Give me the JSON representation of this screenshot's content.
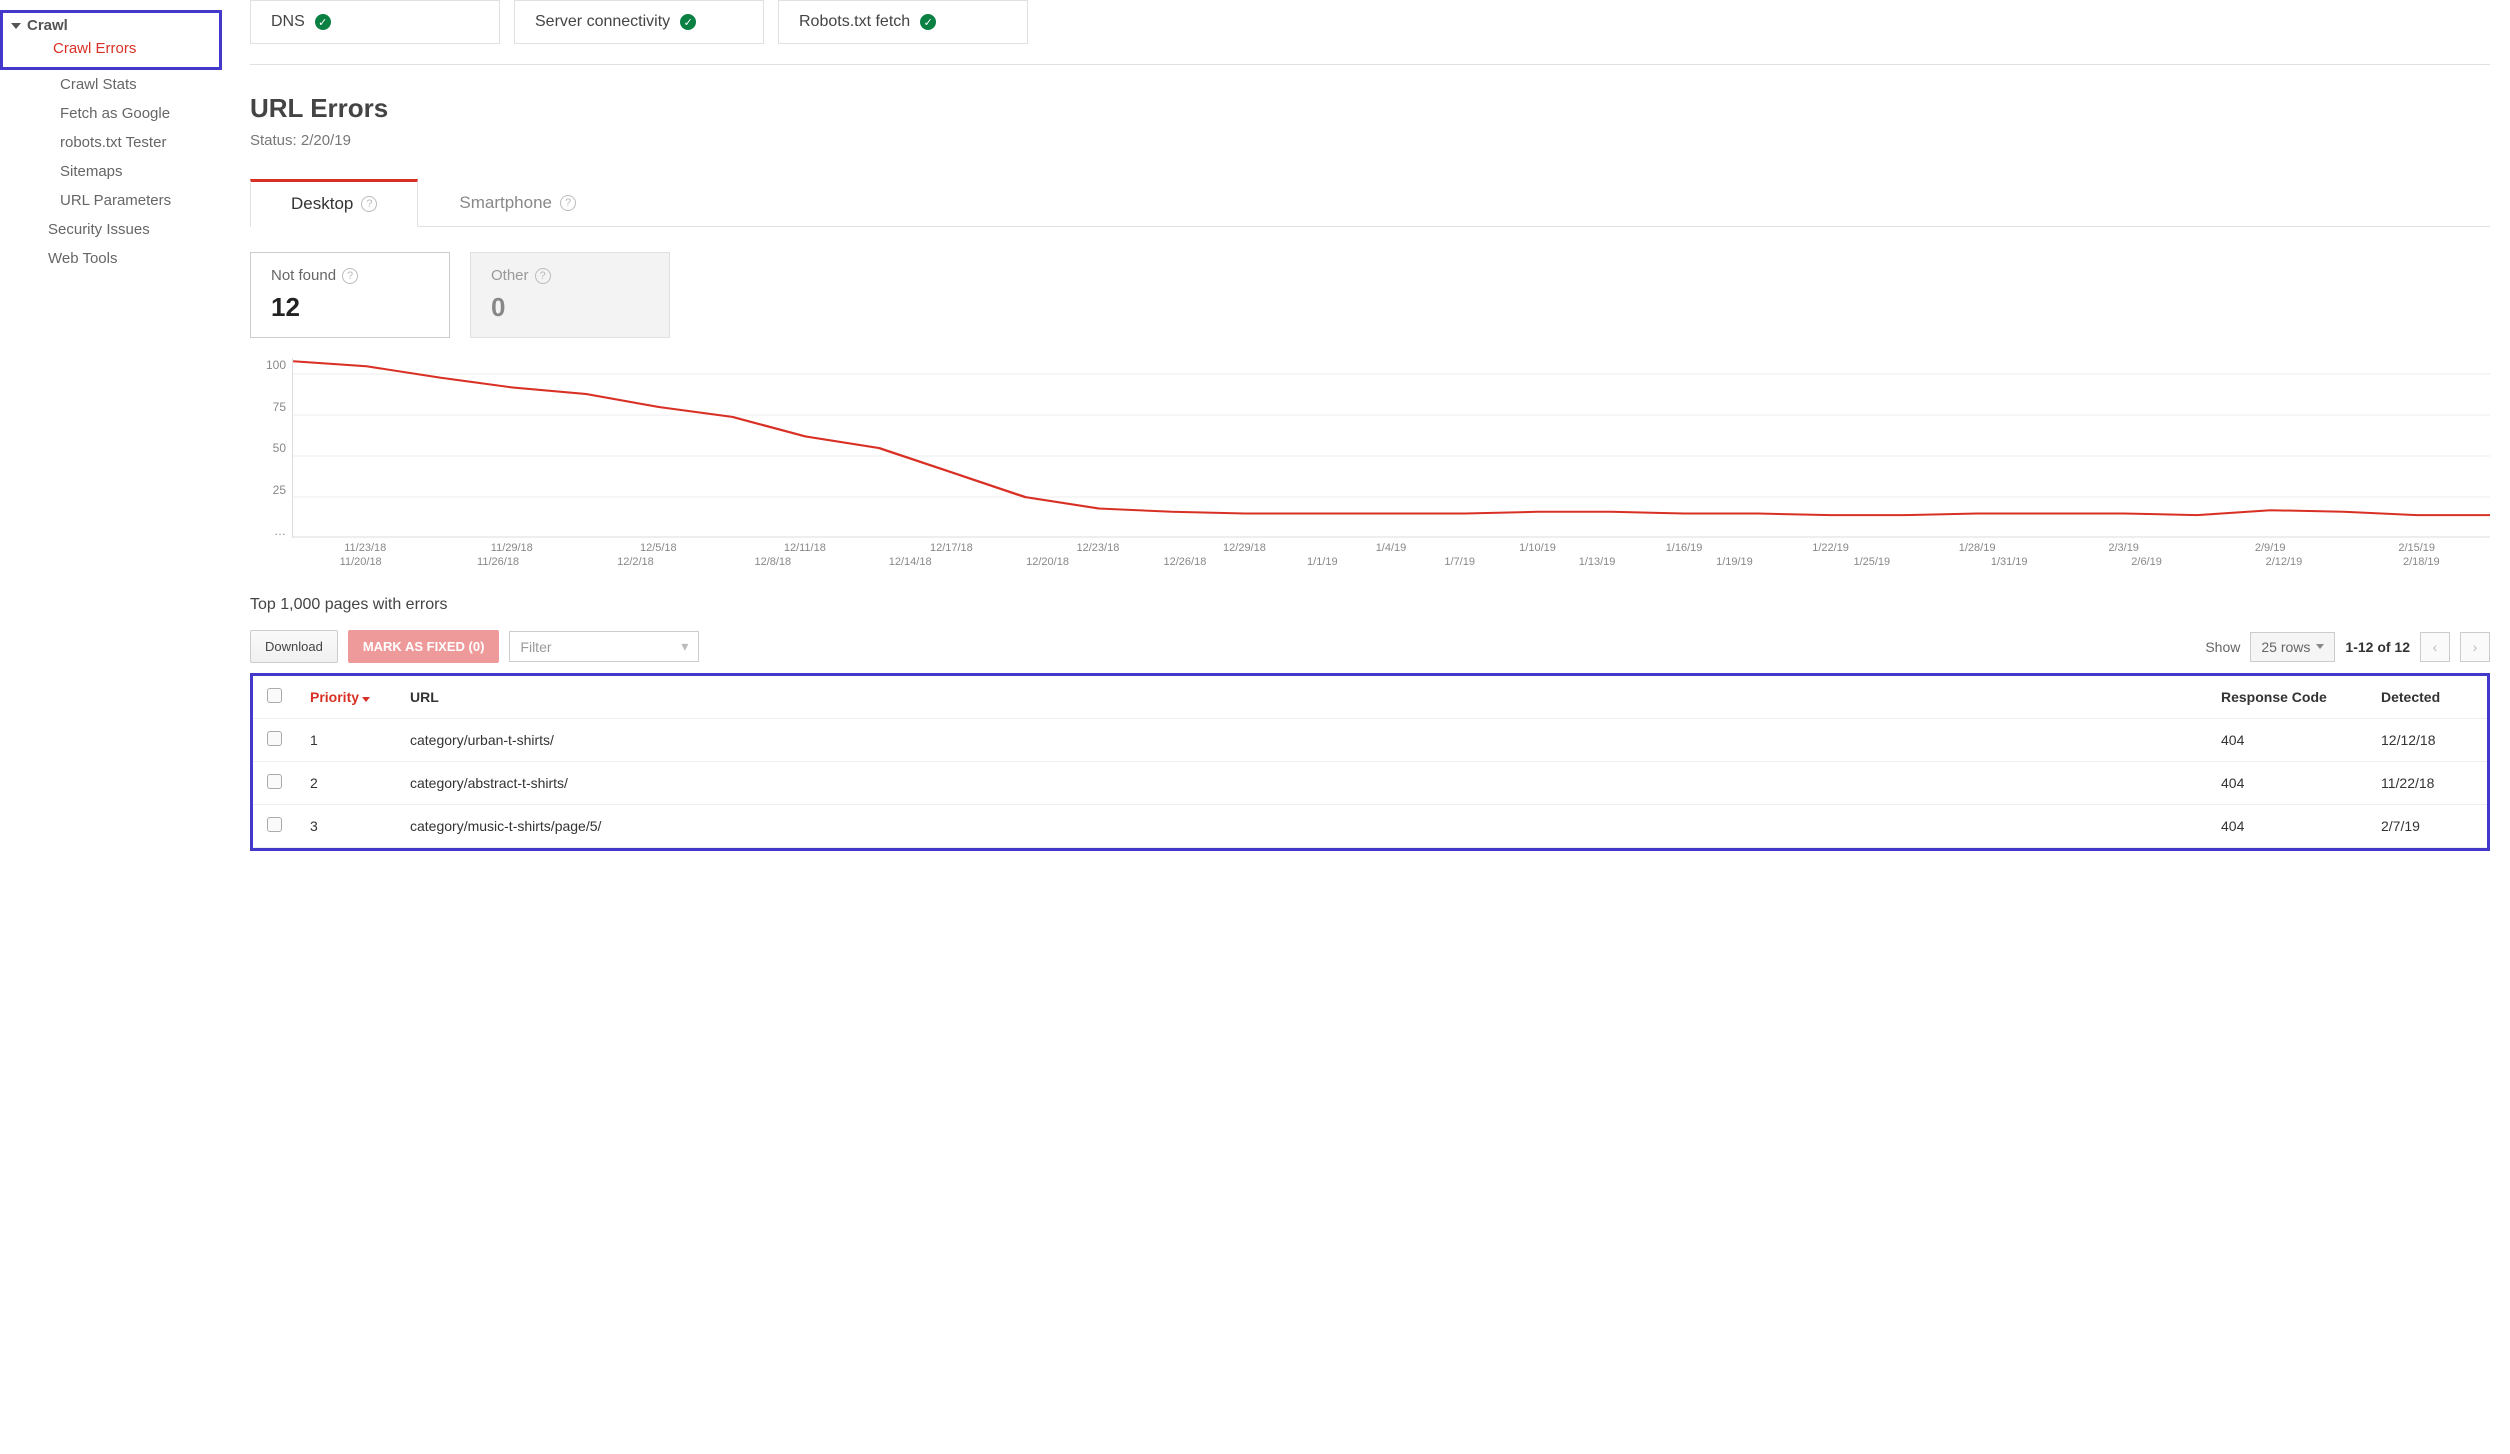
{
  "sidebar": {
    "group_label": "Crawl",
    "items": [
      {
        "label": "Crawl Errors",
        "active": true
      },
      {
        "label": "Crawl Stats"
      },
      {
        "label": "Fetch as Google"
      },
      {
        "label": "robots.txt Tester"
      },
      {
        "label": "Sitemaps"
      },
      {
        "label": "URL Parameters"
      }
    ],
    "security": "Security Issues",
    "webtools": "Web Tools"
  },
  "status_cards": [
    {
      "label": "DNS"
    },
    {
      "label": "Server connectivity"
    },
    {
      "label": "Robots.txt fetch"
    }
  ],
  "section": {
    "title": "URL Errors",
    "status_prefix": "Status: ",
    "status_date": "2/20/19"
  },
  "device_tabs": [
    {
      "label": "Desktop",
      "active": true
    },
    {
      "label": "Smartphone"
    }
  ],
  "error_tiles": [
    {
      "label": "Not found",
      "value": "12",
      "active": true
    },
    {
      "label": "Other",
      "value": "0"
    }
  ],
  "chart_data": {
    "type": "line",
    "ylabel": "",
    "ylim": [
      0,
      110
    ],
    "y_ticks": [
      "100",
      "75",
      "50",
      "25",
      "…"
    ],
    "x_ticks_row1": [
      "11/23/18",
      "11/29/18",
      "12/5/18",
      "12/11/18",
      "12/17/18",
      "12/23/18",
      "12/29/18",
      "1/4/19",
      "1/10/19",
      "1/16/19",
      "1/22/19",
      "1/28/19",
      "2/3/19",
      "2/9/19",
      "2/15/19"
    ],
    "x_ticks_row2": [
      "11/20/18",
      "11/26/18",
      "12/2/18",
      "12/8/18",
      "12/14/18",
      "12/20/18",
      "12/26/18",
      "1/1/19",
      "1/7/19",
      "1/13/19",
      "1/19/19",
      "1/25/19",
      "1/31/19",
      "2/6/19",
      "2/12/19",
      "2/18/19"
    ],
    "series": [
      {
        "name": "Not found",
        "color": "#d93025",
        "x": [
          "11/20/18",
          "11/23/18",
          "11/26/18",
          "11/29/18",
          "12/2/18",
          "12/5/18",
          "12/8/18",
          "12/11/18",
          "12/14/18",
          "12/17/18",
          "12/20/18",
          "12/23/18",
          "12/26/18",
          "12/29/18",
          "1/1/19",
          "1/4/19",
          "1/7/19",
          "1/10/19",
          "1/13/19",
          "1/16/19",
          "1/19/19",
          "1/22/19",
          "1/25/19",
          "1/28/19",
          "1/31/19",
          "2/3/19",
          "2/6/19",
          "2/9/19",
          "2/12/19",
          "2/15/19",
          "2/18/19"
        ],
        "values": [
          108,
          105,
          98,
          92,
          88,
          80,
          74,
          62,
          55,
          40,
          25,
          18,
          16,
          15,
          15,
          15,
          15,
          16,
          16,
          15,
          15,
          14,
          14,
          15,
          15,
          15,
          14,
          17,
          16,
          14,
          14
        ]
      }
    ]
  },
  "pages_title": "Top 1,000 pages with errors",
  "buttons": {
    "download": "Download",
    "mark_fixed": "MARK AS FIXED (0)"
  },
  "filter_placeholder": "Filter",
  "pagination": {
    "show_label": "Show",
    "rows_label": "25 rows",
    "range": "1-12 of 12"
  },
  "table": {
    "headers": {
      "priority": "Priority",
      "url": "URL",
      "code": "Response Code",
      "detected": "Detected"
    },
    "rows": [
      {
        "priority": "1",
        "url": "category/urban-t-shirts/",
        "code": "404",
        "detected": "12/12/18"
      },
      {
        "priority": "2",
        "url": "category/abstract-t-shirts/",
        "code": "404",
        "detected": "11/22/18"
      },
      {
        "priority": "3",
        "url": "category/music-t-shirts/page/5/",
        "code": "404",
        "detected": "2/7/19"
      }
    ]
  }
}
